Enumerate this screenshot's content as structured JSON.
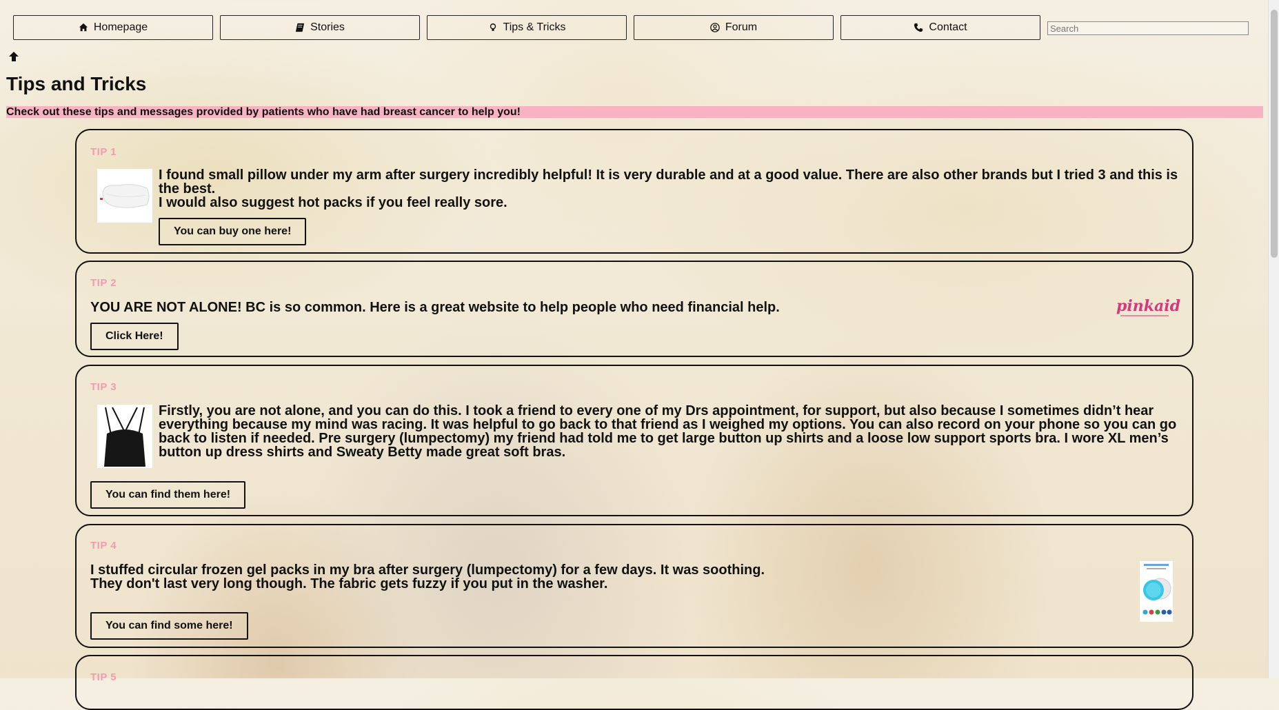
{
  "nav": {
    "items": [
      {
        "label": "Homepage",
        "icon": "home-icon"
      },
      {
        "label": "Stories",
        "icon": "book-icon"
      },
      {
        "label": "Tips & Tricks",
        "icon": "lightbulb-icon"
      },
      {
        "label": "Forum",
        "icon": "user-circle-icon"
      },
      {
        "label": "Contact",
        "icon": "phone-icon"
      }
    ],
    "search_placeholder": "Search"
  },
  "page": {
    "title": "Tips and Tricks",
    "intro": "Check out these tips and messages provided by patients who have had breast cancer to help you!",
    "accent_color": "#f7b3c2",
    "label_color": "#f29bb0"
  },
  "tips": [
    {
      "label": "TIP 1",
      "lines": [
        "I found small pillow under my arm after surgery incredibly helpful! It is very durable and at a good value. There are also other brands but I tried 3 and this is the best.",
        "I would also suggest hot packs if you feel really sore."
      ],
      "button": "You can buy one here!",
      "image": "pillow-image"
    },
    {
      "label": "TIP 2",
      "lines": [
        "YOU ARE NOT ALONE! BC is so common. Here is a great website to help people who need financial help."
      ],
      "button": "Click Here!",
      "image": "pinkaid-logo",
      "logo_text": "pinkaid"
    },
    {
      "label": "TIP 3",
      "lines": [
        "Firstly, you are not alone, and you can do this. I took a friend to every one of my Drs appointment, for support, but also because I sometimes didn’t hear everything because my mind was racing. It was helpful to go back to that friend as I weighed my options. You can also record on your phone so you can go back to listen if needed. Pre surgery (lumpectomy) my friend had told me to get large button up shirts and a loose low support sports bra. I wore XL men’s button up dress shirts and Sweaty Betty made great soft bras."
      ],
      "button": "You can find them here!",
      "image": "sports-bra-image"
    },
    {
      "label": "TIP 4",
      "lines": [
        "I stuffed circular frozen gel packs in my bra after surgery (lumpectomy) for a few days. It was soothing.",
        "They don't last very long though. The fabric gets fuzzy if you put in the washer."
      ],
      "button": "You can find some here!",
      "image": "gel-pack-image"
    },
    {
      "label": "TIP 5"
    }
  ]
}
